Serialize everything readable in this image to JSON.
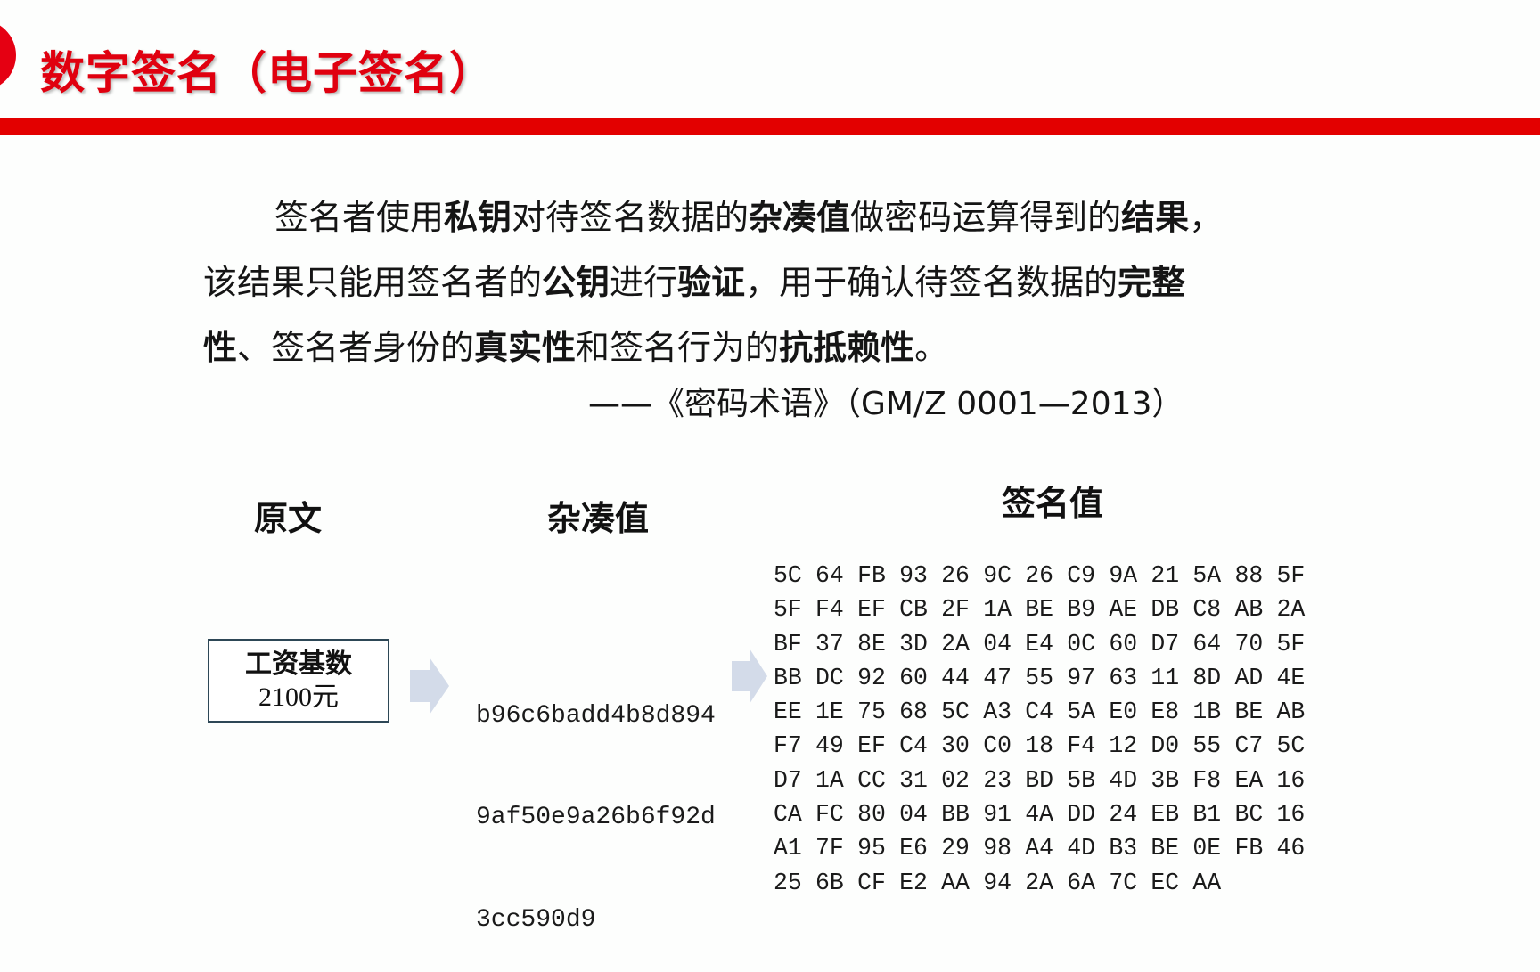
{
  "slide": {
    "title": "数字签名（电子签名）",
    "colors": {
      "accent_red": "#e30000",
      "arrow": "#d3dbe9",
      "box_border": "#2d4756"
    }
  },
  "definition": {
    "lines": [
      [
        {
          "text": "签名者使用",
          "bold": false
        },
        {
          "text": "私钥",
          "bold": true
        },
        {
          "text": "对待签名数据的",
          "bold": false
        },
        {
          "text": "杂凑值",
          "bold": true
        },
        {
          "text": "做密码运算得到的",
          "bold": false
        },
        {
          "text": "结果",
          "bold": true
        },
        {
          "text": "，",
          "bold": false
        }
      ],
      [
        {
          "text": "该结果只能用签名者的",
          "bold": false
        },
        {
          "text": "公钥",
          "bold": true
        },
        {
          "text": "进行",
          "bold": false
        },
        {
          "text": "验证",
          "bold": true
        },
        {
          "text": "，用于确认待签名数据的",
          "bold": false
        },
        {
          "text": "完整",
          "bold": true
        }
      ],
      [
        {
          "text": "性",
          "bold": true
        },
        {
          "text": "、签名者身份的",
          "bold": false
        },
        {
          "text": "真实性",
          "bold": true
        },
        {
          "text": "和签名行为的",
          "bold": false
        },
        {
          "text": "抗抵赖性",
          "bold": true
        },
        {
          "text": "。",
          "bold": false
        }
      ]
    ],
    "citation": "——《密码术语》（GM/Z 0001—2013）"
  },
  "diagram": {
    "headings": {
      "original": "原文",
      "hash": "杂凑值",
      "signature": "签名值"
    },
    "original_box": {
      "line1": "工资基数",
      "line2": "2100元"
    },
    "arrow_icons": [
      "arrow-right-icon",
      "arrow-right-icon"
    ],
    "hash_lines": [
      "b96c6badd4b8d894",
      "9af50e9a26b6f92d",
      "3cc590d9"
    ],
    "signature_rows": [
      [
        "5C",
        "64",
        "FB",
        "93",
        "26",
        "9C",
        "26",
        "C9",
        "9A",
        "21",
        "5A",
        "88",
        "5F"
      ],
      [
        "5F",
        "F4",
        "EF",
        "CB",
        "2F",
        "1A",
        "BE",
        "B9",
        "AE",
        "DB",
        "C8",
        "AB",
        "2A"
      ],
      [
        "BF",
        "37",
        "8E",
        "3D",
        "2A",
        "04",
        "E4",
        "0C",
        "60",
        "D7",
        "64",
        "70",
        "5F"
      ],
      [
        "BB",
        "DC",
        "92",
        "60",
        "44",
        "47",
        "55",
        "97",
        "63",
        "11",
        "8D",
        "AD",
        "4E"
      ],
      [
        "EE",
        "1E",
        "75",
        "68",
        "5C",
        "A3",
        "C4",
        "5A",
        "E0",
        "E8",
        "1B",
        "BE",
        "AB"
      ],
      [
        "F7",
        "49",
        "EF",
        "C4",
        "30",
        "C0",
        "18",
        "F4",
        "12",
        "D0",
        "55",
        "C7",
        "5C"
      ],
      [
        "D7",
        "1A",
        "CC",
        "31",
        "02",
        "23",
        "BD",
        "5B",
        "4D",
        "3B",
        "F8",
        "EA",
        "16"
      ],
      [
        "CA",
        "FC",
        "80",
        "04",
        "BB",
        "91",
        "4A",
        "DD",
        "24",
        "EB",
        "B1",
        "BC",
        "16"
      ],
      [
        "A1",
        "7F",
        "95",
        "E6",
        "29",
        "98",
        "A4",
        "4D",
        "B3",
        "BE",
        "0E",
        "FB",
        "46"
      ],
      [
        "25",
        "6B",
        "CF",
        "E2",
        "AA",
        "94",
        "2A",
        "6A",
        "7C",
        "EC",
        "AA"
      ]
    ]
  }
}
